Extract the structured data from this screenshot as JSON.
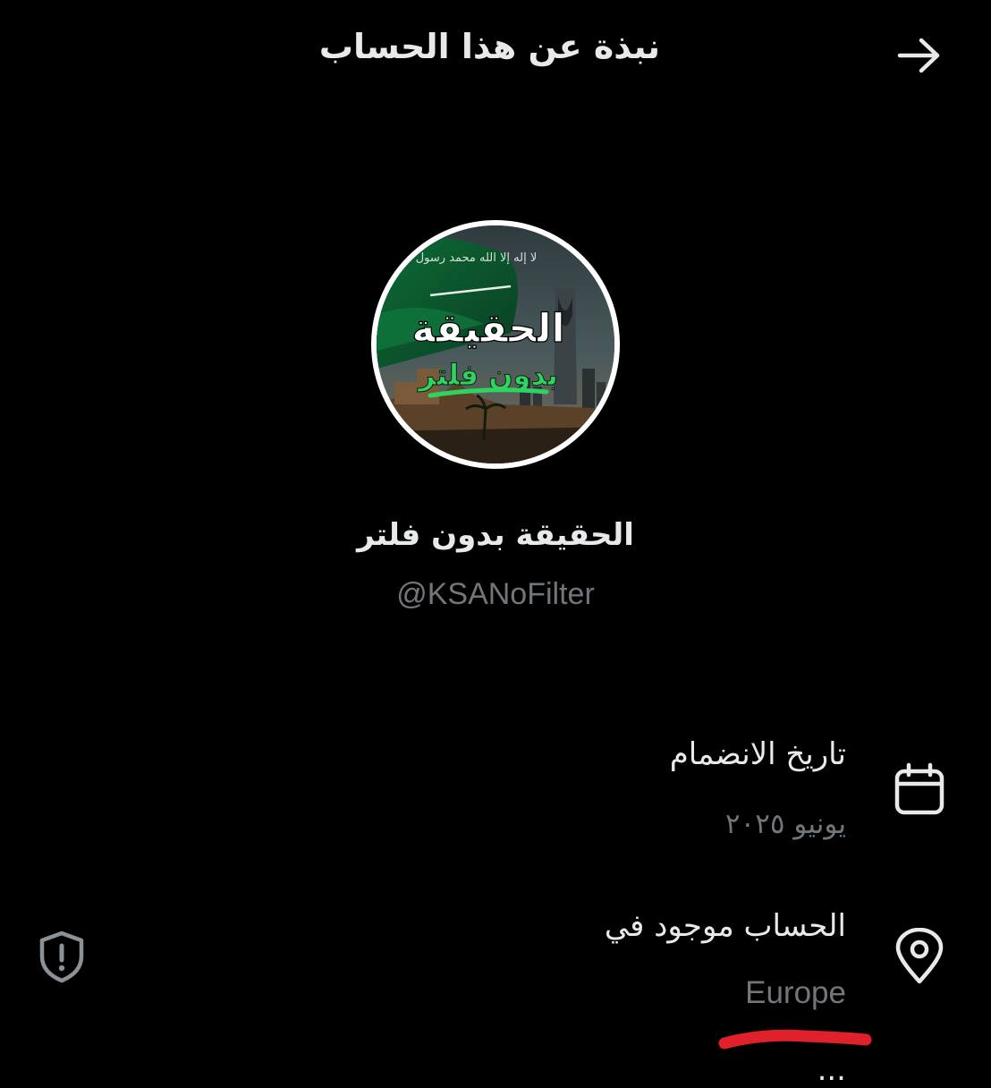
{
  "header": {
    "title": "نبذة عن هذا الحساب",
    "back_icon": "arrow-right-icon"
  },
  "profile": {
    "avatar": {
      "headline": "الحقيقة",
      "subline": "بدون فلتر",
      "flag_script": "لا إله إلا الله محمد رسول الله"
    },
    "display_name": "الحقيقة بدون فلتر",
    "handle": "@KSANoFilter"
  },
  "joined": {
    "label": "تاريخ الانضمام",
    "value": "يونيو ٢٠٢٥",
    "icon": "calendar-icon"
  },
  "location": {
    "label": "الحساب موجود في",
    "value": "Europe",
    "icon": "location-pin-icon",
    "side_icon": "shield-alert-icon"
  },
  "cutoff_row": {
    "label": "..."
  },
  "colors": {
    "background": "#000000",
    "primary_text": "#e7e9ea",
    "secondary_text": "#71767b",
    "annotation": "#e0202a"
  }
}
